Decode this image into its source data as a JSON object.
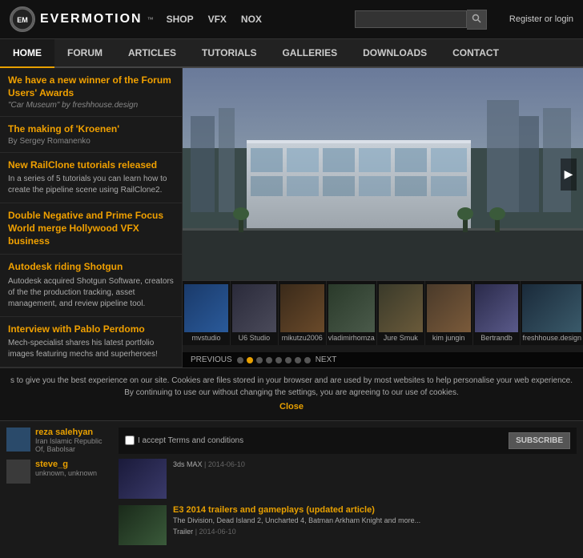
{
  "header": {
    "logo_text": "EVERMOTION",
    "logo_tm": "™",
    "nav": [
      {
        "label": "SHOP",
        "href": "#"
      },
      {
        "label": "VFX",
        "href": "#"
      },
      {
        "label": "NOX",
        "href": "#"
      }
    ],
    "search_placeholder": "",
    "auth_label": "Register or login"
  },
  "main_nav": [
    {
      "label": "HOME",
      "active": true
    },
    {
      "label": "FORUM",
      "active": false
    },
    {
      "label": "ARTICLES",
      "active": false
    },
    {
      "label": "TUTORIALS",
      "active": false
    },
    {
      "label": "GALLERIES",
      "active": false
    },
    {
      "label": "DOWNLOADS",
      "active": false
    },
    {
      "label": "CONTACT",
      "active": false
    }
  ],
  "sidebar": {
    "items": [
      {
        "title": "We have a new winner of the Forum Users' Awards",
        "subtitle": "\"Car Museum\" by freshhouse.design",
        "desc": ""
      },
      {
        "title": "The making of 'Kroenen'",
        "subtitle": "By Sergey Romanenko",
        "desc": ""
      },
      {
        "title": "New RailClone tutorials released",
        "desc": "In a series of 5 tutorials you can learn how to create the pipeline scene using RailClone2."
      },
      {
        "title": "Double Negative and Prime Focus World merge Hollywood VFX business",
        "desc": ""
      },
      {
        "title": "Autodesk riding Shotgun",
        "desc": "Autodesk acquired Shotgun Software, creators of the the production tracking, asset management, and review pipeline tool."
      },
      {
        "title": "Interview with Pablo Perdomo",
        "desc": "Mech-specialist shares his latest portfolio images featuring mechs and superheroes!"
      }
    ]
  },
  "slideshow": {
    "prev_label": "PREVIOUS",
    "next_label": "NEXT",
    "dots": [
      1,
      2,
      3,
      4,
      5,
      6,
      7,
      8
    ],
    "active_dot": 2
  },
  "thumbnails": [
    {
      "label": "mvstudio",
      "class": "t1"
    },
    {
      "label": "U6 Studio",
      "class": "t2"
    },
    {
      "label": "mikutzu2006",
      "class": "t3"
    },
    {
      "label": "vladimirhomza",
      "class": "t4"
    },
    {
      "label": "Jure Smuk",
      "class": "t5"
    },
    {
      "label": "kim jungin",
      "class": "t6"
    },
    {
      "label": "Bertrandb",
      "class": "t7"
    },
    {
      "label": "freshhouse.design",
      "class": "t8"
    }
  ],
  "cookie_bar": {
    "text": "s to give you the best experience on our site. Cookies are files stored in your browser and are used by most websites to help personalise your web experience. By continuing to use our without changing the settings, you are agreeing to our use of cookies.",
    "close_label": "Close"
  },
  "newsletter": {
    "checkbox_label": "I accept Terms and conditions",
    "subscribe_label": "SUBSCRIBE"
  },
  "users": [
    {
      "name": "reza salehyan",
      "location": "Iran Islamic Republic Of, Babolsar"
    },
    {
      "name": "steve_g",
      "location": "unknown, unknown"
    }
  ],
  "articles": [
    {
      "title": "3ds MAX | 2014-06-10",
      "tag": "3ds MAX",
      "date": "2014-06-10",
      "thumb_class": "at1"
    },
    {
      "title": "E3 2014 trailers and gameplays (updated article)",
      "desc": "The Division, Dead Island 2, Uncharted 4, Batman Arkham Knight and more...",
      "tag": "Trailer",
      "date": "2014-06-10",
      "thumb_class": "at2"
    }
  ]
}
